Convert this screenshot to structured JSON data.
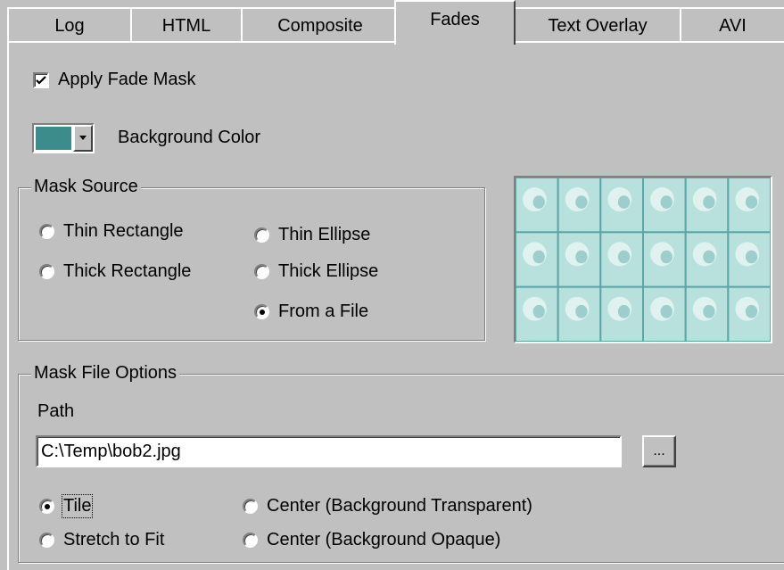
{
  "tabs": [
    {
      "label": "Log"
    },
    {
      "label": "HTML"
    },
    {
      "label": "Composite"
    },
    {
      "label": "Fades",
      "active": true
    },
    {
      "label": "Text Overlay"
    },
    {
      "label": "AVI"
    }
  ],
  "apply_fade_mask": {
    "label": "Apply Fade Mask",
    "checked": true
  },
  "background_color": {
    "label": "Background Color",
    "value": "#3c8c8c"
  },
  "mask_source": {
    "legend": "Mask Source",
    "options": [
      {
        "label": "Thin Rectangle",
        "selected": false
      },
      {
        "label": "Thick Rectangle",
        "selected": false
      },
      {
        "label": "Thin Ellipse",
        "selected": false
      },
      {
        "label": "Thick Ellipse",
        "selected": false
      },
      {
        "label": "From a File",
        "selected": true
      }
    ]
  },
  "mask_file_options": {
    "legend": "Mask File Options",
    "path_label": "Path",
    "path_value": "C:\\Temp\\bob2.jpg",
    "browse_label": "...",
    "options": [
      {
        "label": "Tile",
        "selected": true
      },
      {
        "label": "Stretch to Fit",
        "selected": false
      },
      {
        "label": "Center (Background Transparent)",
        "selected": false
      },
      {
        "label": "Center (Background Opaque)",
        "selected": false
      }
    ]
  },
  "colors": {
    "panel": "#c0c0c0",
    "preview_tile": "#b8e0dd",
    "preview_grid": "#5aa8a5"
  }
}
